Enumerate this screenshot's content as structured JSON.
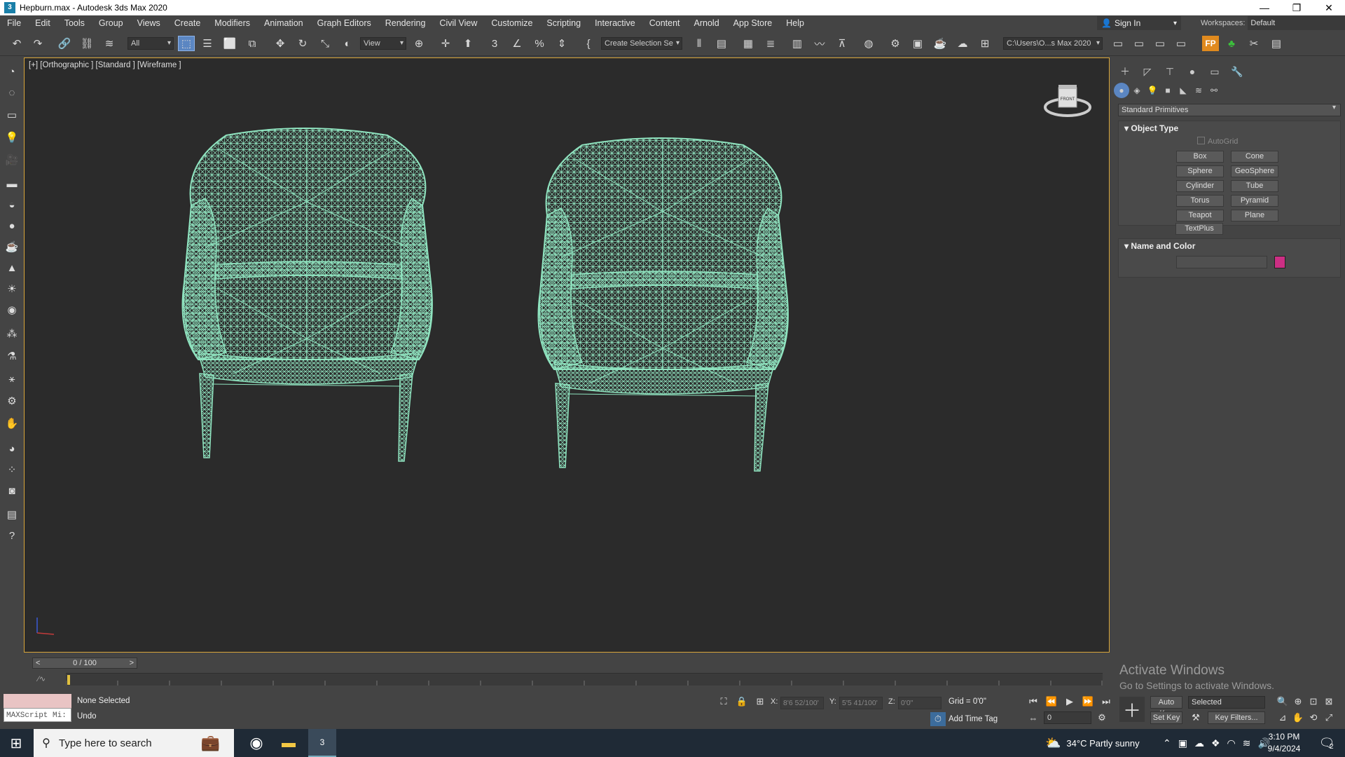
{
  "window": {
    "title": "Hepburn.max - Autodesk 3ds Max 2020",
    "app_icon": "3",
    "controls": [
      "minimize-icon",
      "restore-icon",
      "close-icon"
    ]
  },
  "menu": [
    "File",
    "Edit",
    "Tools",
    "Group",
    "Views",
    "Create",
    "Modifiers",
    "Animation",
    "Graph Editors",
    "Rendering",
    "Civil View",
    "Customize",
    "Scripting",
    "Interactive",
    "Content",
    "Arnold",
    "App Store",
    "Help"
  ],
  "account": {
    "sign_in": "Sign In",
    "workspaces_label": "Workspaces:",
    "workspace": "Default"
  },
  "toolbar": {
    "filter": "All",
    "ref_coord": "View",
    "selection_set": "Create Selection Se",
    "project_path": "C:\\Users\\O...s Max 2020"
  },
  "viewport": {
    "label": "[+] [Orthographic ] [Standard ] [Wireframe ]",
    "viewcube_face": "FRONT",
    "wire_color": "#8fe3bf",
    "objects": [
      "armchair-left",
      "armchair-right"
    ]
  },
  "command_panel": {
    "category": "Standard Primitives",
    "object_type": {
      "title": "Object Type",
      "autogrid": "AutoGrid",
      "buttons": [
        "Box",
        "Cone",
        "Sphere",
        "GeoSphere",
        "Cylinder",
        "Tube",
        "Torus",
        "Pyramid",
        "Teapot",
        "Plane",
        "TextPlus"
      ]
    },
    "name_and_color": {
      "title": "Name and Color",
      "name": "",
      "color": "#cc2f84"
    }
  },
  "timeline": {
    "frame": "0 / 100",
    "prev": "<",
    "next": ">"
  },
  "status": {
    "maxscript": "MAXScript Mi:",
    "selection": "None Selected",
    "prompt": "Undo",
    "x_label": "X:",
    "x": "8'6 52/100'",
    "y_label": "Y:",
    "y": "5'5 41/100'",
    "z_label": "Z:",
    "z": "0'0\"",
    "grid": "Grid = 0'0\"",
    "add_time_tag": "Add Time Tag",
    "auto_key": "Auto Key",
    "set_key": "Set Key",
    "key_mode": "Selected",
    "key_filters": "Key Filters...",
    "current_frame": "0"
  },
  "watermark": {
    "line1": "Activate Windows",
    "line2": "Go to Settings to activate Windows."
  },
  "taskbar": {
    "search_placeholder": "Type here to search",
    "weather": "34°C  Partly sunny",
    "time": "3:10 PM",
    "date": "9/4/2024",
    "notif_count": "2"
  }
}
